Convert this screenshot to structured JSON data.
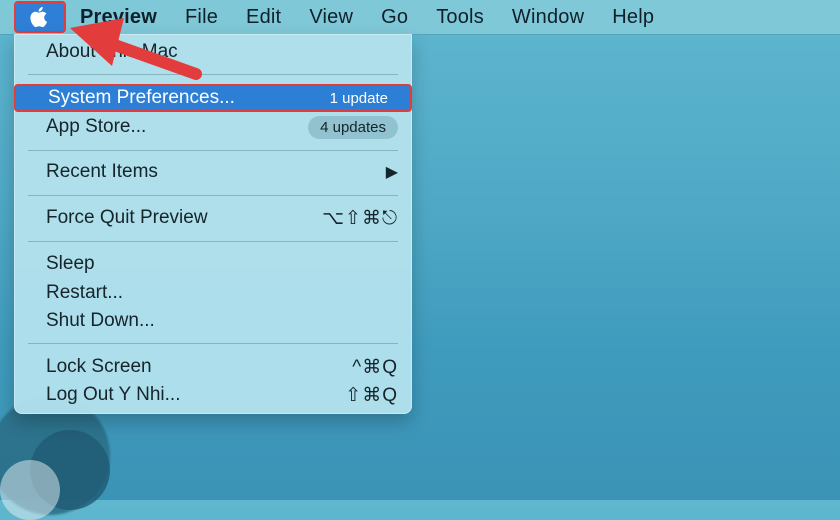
{
  "menubar": {
    "apple_icon": "apple-logo-icon",
    "app_name": "Preview",
    "items": [
      "File",
      "Edit",
      "View",
      "Go",
      "Tools",
      "Window",
      "Help"
    ]
  },
  "apple_menu": {
    "about": "About This Mac",
    "system_preferences": {
      "label": "System Preferences...",
      "badge": "1 update"
    },
    "app_store": {
      "label": "App Store...",
      "badge": "4 updates"
    },
    "recent_items": {
      "label": "Recent Items",
      "submenu_icon": "▶"
    },
    "force_quit": {
      "label": "Force Quit Preview",
      "shortcut": "⌥⇧⌘⎋"
    },
    "sleep": "Sleep",
    "restart": "Restart...",
    "shut_down": "Shut Down...",
    "lock_screen": {
      "label": "Lock Screen",
      "shortcut": "^⌘Q"
    },
    "log_out": {
      "label": "Log Out Y Nhi...",
      "shortcut": "⇧⌘Q"
    }
  },
  "colors": {
    "highlight": "#2c7fd4",
    "annotation_red": "#e23c3c"
  }
}
